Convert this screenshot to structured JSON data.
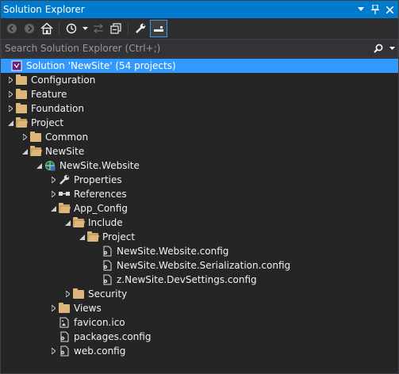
{
  "panel": {
    "title": "Solution Explorer"
  },
  "search": {
    "placeholder": "Search Solution Explorer (Ctrl+;)"
  },
  "tree": {
    "solution": "Solution 'NewSite' (54 projects)",
    "configuration": "Configuration",
    "feature": "Feature",
    "foundation": "Foundation",
    "project": "Project",
    "common": "Common",
    "newsite": "NewSite",
    "website": "NewSite.Website",
    "properties": "Properties",
    "references": "References",
    "app_config": "App_Config",
    "include": "Include",
    "include_project": "Project",
    "config1": "NewSite.Website.config",
    "config2": "NewSite.Website.Serialization.config",
    "config3": "z.NewSite.DevSettings.config",
    "security": "Security",
    "views": "Views",
    "favicon": "favicon.ico",
    "packages": "packages.config",
    "webconfig": "web.config"
  },
  "colors": {
    "accent": "#007acc",
    "selection": "#3399ff",
    "folder": "#dcb67a",
    "background": "#252526"
  }
}
